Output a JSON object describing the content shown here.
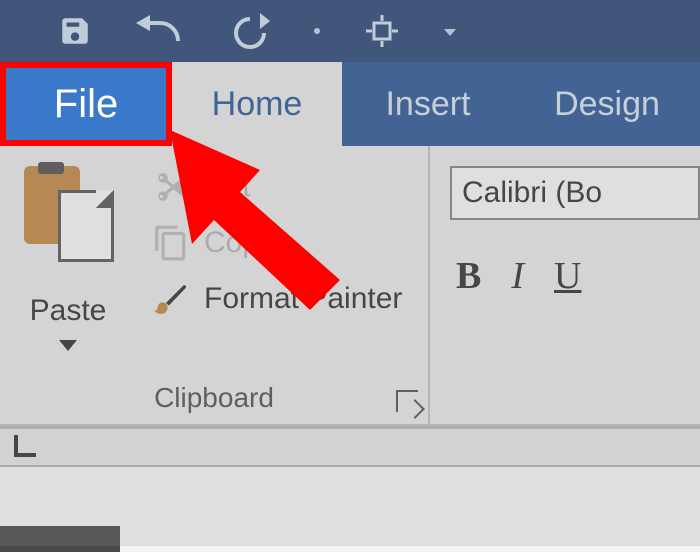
{
  "quick_access": {
    "save_icon": "save-icon",
    "undo_icon": "undo-icon",
    "redo_icon": "redo-icon",
    "touch_icon": "touch-mode-icon"
  },
  "tabs": {
    "file": "File",
    "home": "Home",
    "insert": "Insert",
    "design": "Design"
  },
  "ribbon": {
    "clipboard": {
      "paste_label": "Paste",
      "cut_label": "Cut",
      "copy_label": "Copy",
      "format_painter_label": "Format Painter",
      "group_name": "Clipboard"
    },
    "font": {
      "font_name_value": "Calibri (Bo",
      "bold_label": "B",
      "italic_label": "I",
      "underline_label": "U"
    }
  },
  "annotation": {
    "highlight_target": "file-tab",
    "arrow_color": "#ff0000"
  }
}
